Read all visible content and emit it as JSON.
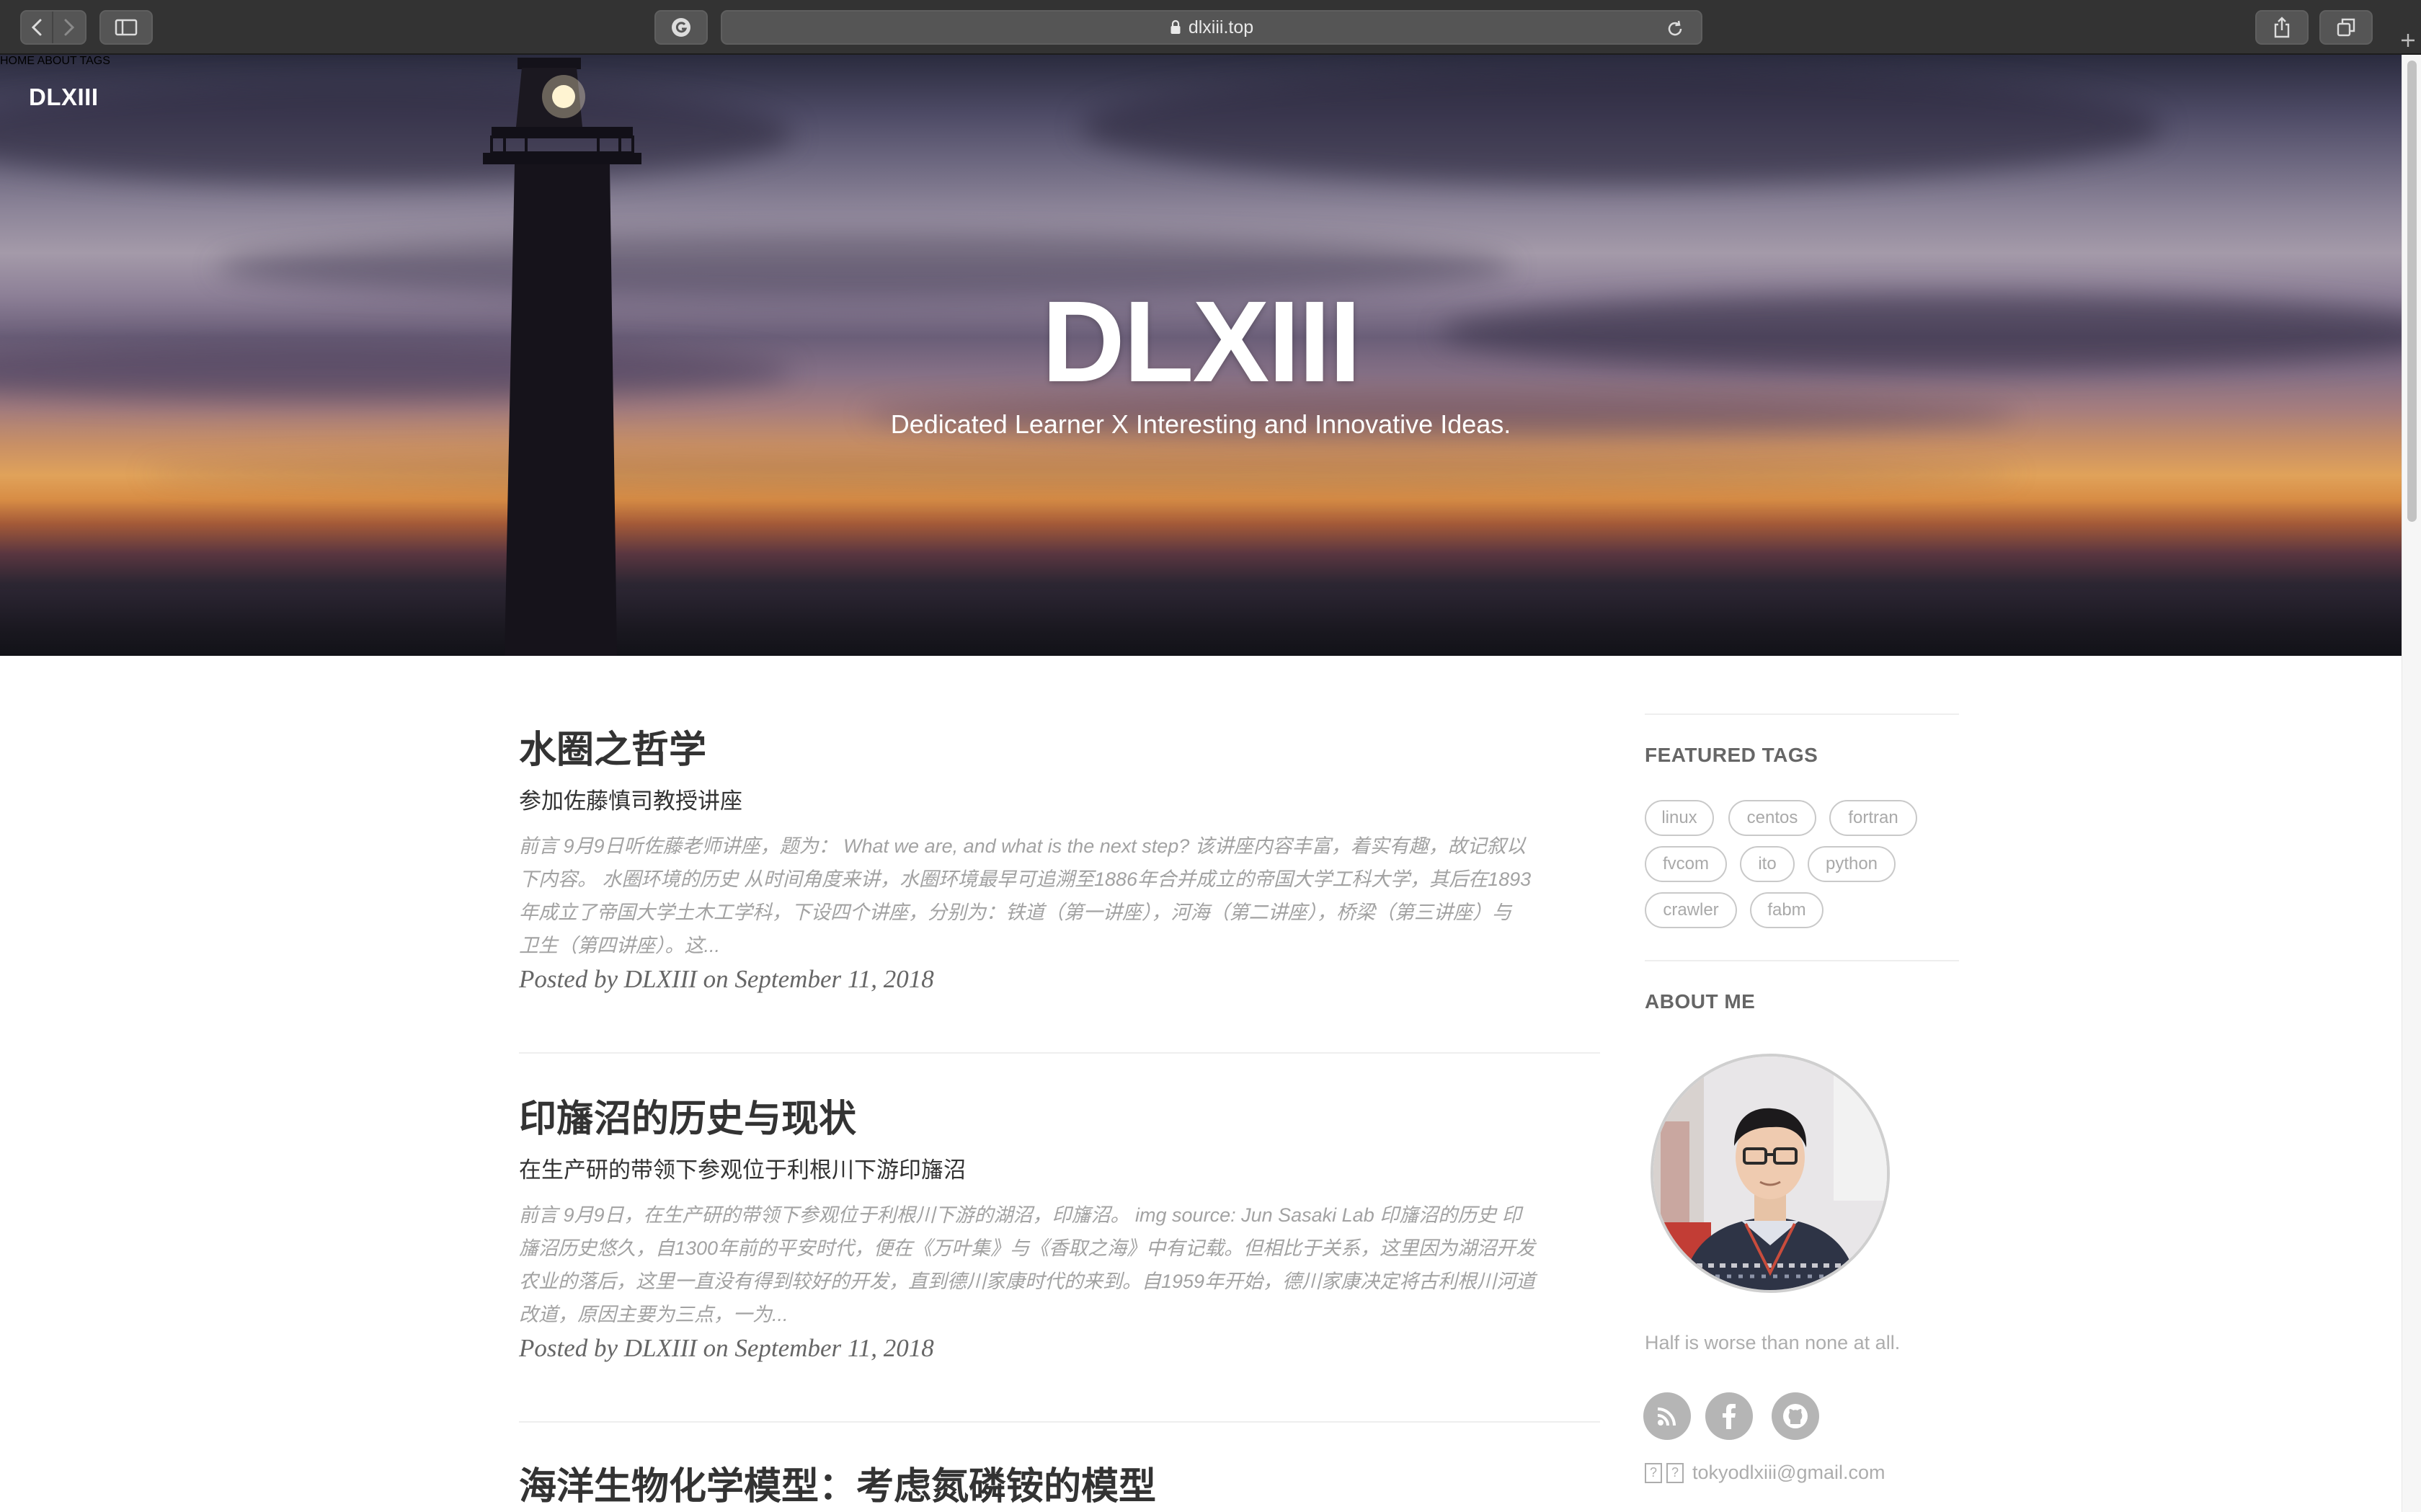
{
  "browser": {
    "url": "dlxiii.top"
  },
  "site": {
    "brand": "DLXIII",
    "nav": [
      {
        "label": "HOME"
      },
      {
        "label": "ABOUT"
      },
      {
        "label": "TAGS"
      }
    ],
    "hero_title": "DLXIII",
    "hero_subtitle": "Dedicated Learner X Interesting and Innovative Ideas."
  },
  "posts": [
    {
      "title": "水圈之哲学",
      "subtitle": "参加佐藤慎司教授讲座",
      "excerpt_lines": [
        "前言 9月9日听佐藤老师讲座，题为： What we are, and what is the next step? 该讲座内容丰富，着实有趣，故记叙以",
        "下内容。 水圈环境的历史 从时间角度来讲，水圈环境最早可追溯至1886年合并成立的帝国大学工科大学，其后在1893",
        "年成立了帝国大学土木工学科，下设四个讲座，分别为：铁道（第一讲座），河海（第二讲座），桥梁（第三讲座）与",
        "卫生（第四讲座）。这..."
      ],
      "meta": "Posted by DLXIII on September 11, 2018"
    },
    {
      "title": "印旛沼的历史与现状",
      "subtitle": "在生产研的带领下参观位于利根川下游印旛沼",
      "excerpt_lines": [
        "前言 9月9日，在生产研的带领下参观位于利根川下游的湖沼，印旛沼。 img source: Jun Sasaki Lab 印旛沼的历史 印",
        "旛沼历史悠久，自1300年前的平安时代，便在《万叶集》与《香取之海》中有记载。但相比于关系，这里因为湖沼开发",
        "农业的落后，这里一直没有得到较好的开发，直到德川家康时代的来到。自1959年开始，德川家康决定将古利根川河道",
        "改道，原因主要为三点，一为..."
      ],
      "meta": "Posted by DLXIII on September 11, 2018"
    },
    {
      "title": "海洋生物化学模型：考虑氮磷铵的模型"
    }
  ],
  "sidebar": {
    "featured_tags_heading": "FEATURED TAGS",
    "tags": [
      "linux",
      "centos",
      "fortran",
      "fvcom",
      "ito",
      "python",
      "crawler",
      "fabm"
    ],
    "about_heading": "ABOUT ME",
    "motto": "Half is worse than none at all.",
    "email": "tokyodlxiii@gmail.com",
    "email_prefix": "?",
    "social": [
      {
        "icon": "rss-icon"
      },
      {
        "icon": "facebook-icon"
      },
      {
        "icon": "github-icon"
      }
    ]
  },
  "colors": {
    "accent_text": "#333333",
    "muted_text": "#a2a2a2",
    "tag_border": "#c9c9c9",
    "social_bg": "#b5b5b5"
  }
}
